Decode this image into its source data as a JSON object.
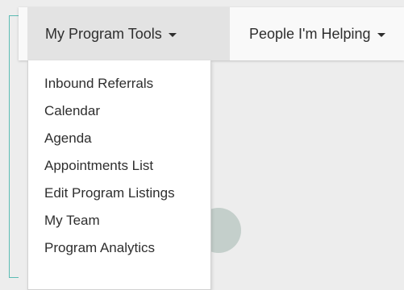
{
  "nav": {
    "tabs": [
      {
        "label": "My Program Tools"
      },
      {
        "label": "People I'm Helping"
      }
    ]
  },
  "dropdown": {
    "items": [
      {
        "label": "Inbound Referrals"
      },
      {
        "label": "Calendar"
      },
      {
        "label": "Agenda"
      },
      {
        "label": "Appointments List"
      },
      {
        "label": "Edit Program Listings"
      },
      {
        "label": "My Team"
      },
      {
        "label": "Program Analytics"
      }
    ]
  },
  "colors": {
    "accent_bracket": "#5cbcb4",
    "active_tab_bg": "#e3e3e3",
    "page_bg": "#ededed"
  }
}
